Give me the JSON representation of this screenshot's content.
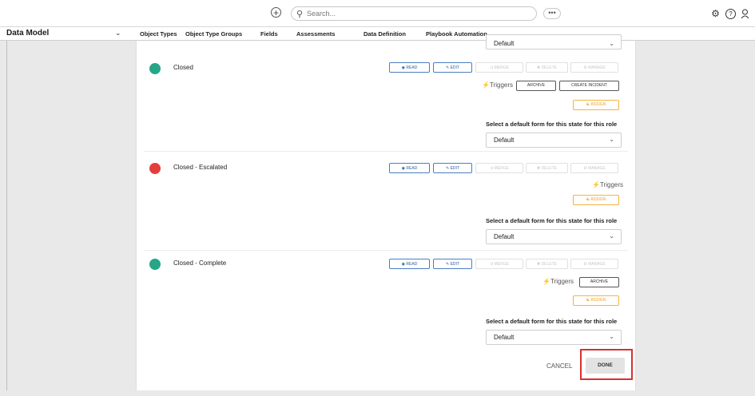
{
  "topbar": {
    "add_icon": "plus-circle-icon",
    "search_placeholder": "Search...",
    "more_label": "•••",
    "icons": [
      "gear-icon",
      "help-icon",
      "user-icon"
    ]
  },
  "navbar": {
    "title": "Data Model",
    "chevron": "⌄",
    "items": [
      "Object Types",
      "Object Type Groups",
      "Fields",
      "Assessments",
      "Data Definition",
      "Playbook Automation"
    ]
  },
  "top_select_value": "Default",
  "permission_labels": {
    "read": "READ",
    "edit": "EDIT",
    "merge": "MERGE",
    "delete": "DELETE",
    "manage": "MANAGE",
    "read_icon": "◉",
    "edit_icon": "✎",
    "merge_icon": "⇉",
    "delete_icon": "✖",
    "manage_icon": "⚙"
  },
  "triggers_label": "Triggers",
  "assign_label": "ASSIGN",
  "default_form_label": "Select a default form for this state for this role",
  "states": [
    {
      "name": "Closed",
      "color": "#26a687",
      "triggers": [
        "ARCHIVE",
        "CREATE INCIDENT"
      ],
      "default_form": "Default"
    },
    {
      "name": "Closed - Escalated",
      "color": "#e53d3d",
      "triggers": [],
      "default_form": "Default"
    },
    {
      "name": "Closed - Complete",
      "color": "#26a687",
      "triggers": [
        "ARCHIVE"
      ],
      "default_form": "Default"
    }
  ],
  "footer": {
    "cancel_label": "CANCEL",
    "done_label": "DONE",
    "highlight_color": "#d93030"
  }
}
